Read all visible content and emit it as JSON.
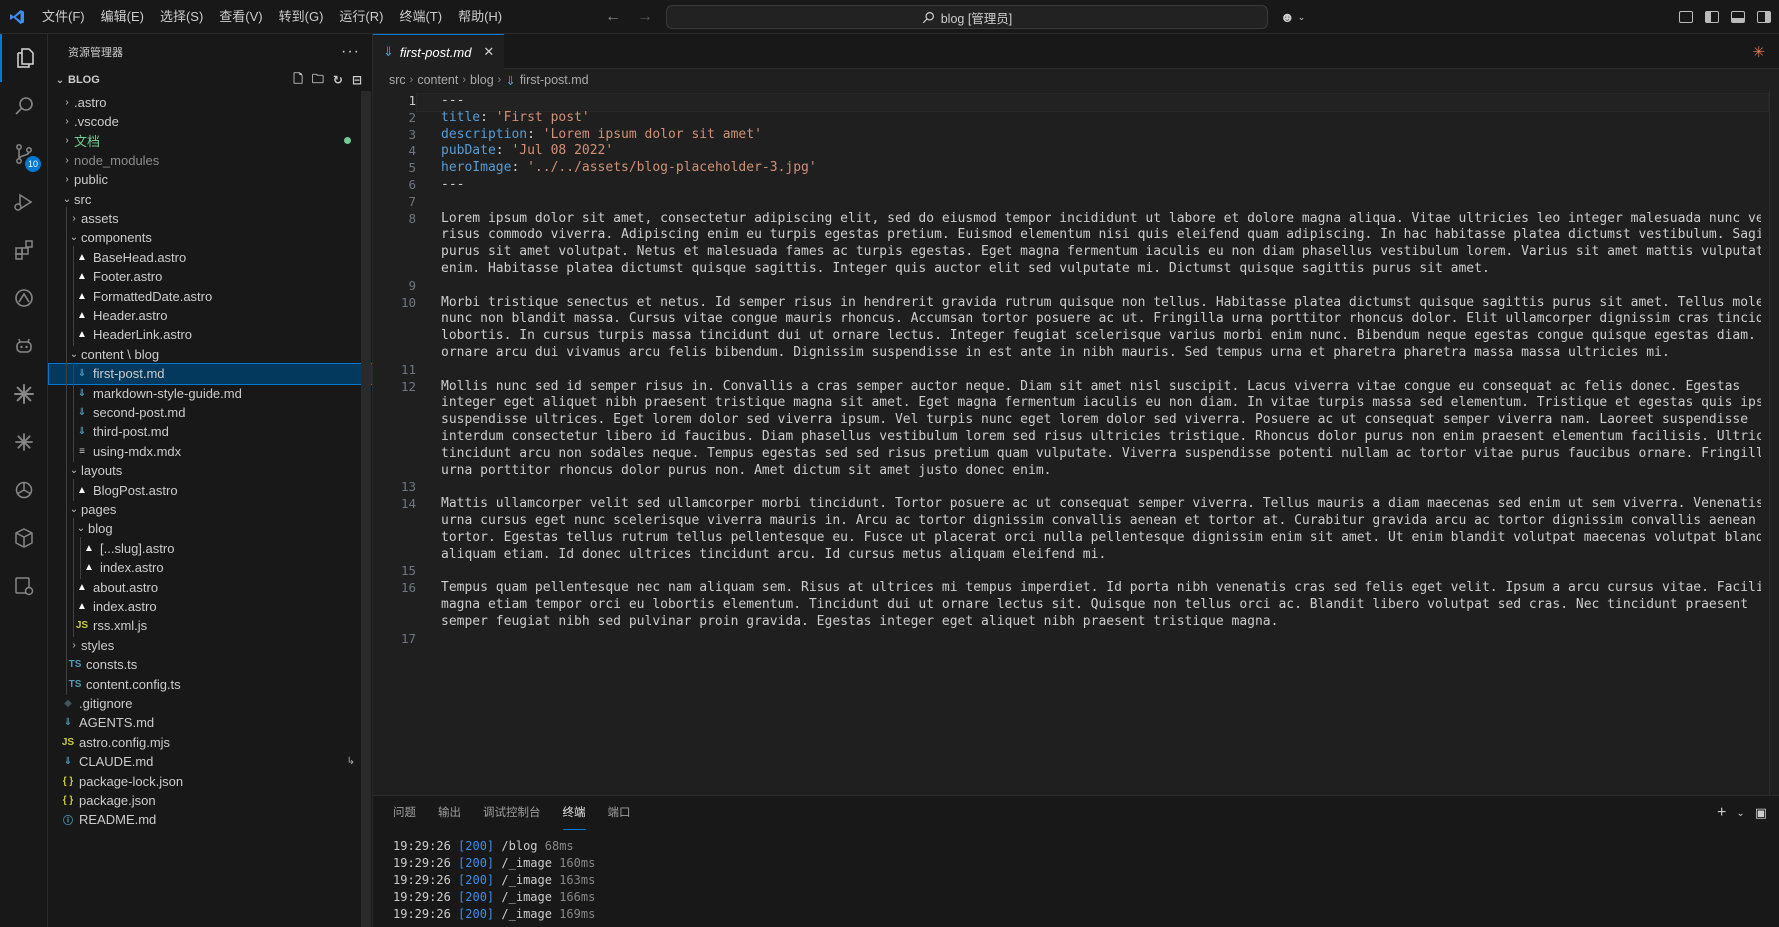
{
  "menu": [
    "文件(F)",
    "编辑(E)",
    "选择(S)",
    "查看(V)",
    "转到(G)",
    "运行(R)",
    "终端(T)",
    "帮助(H)"
  ],
  "search": {
    "text": "blog [管理员]"
  },
  "activity_badge": "10",
  "explorer": {
    "title": "资源管理器",
    "more": "···",
    "root": "BLOG",
    "items": [
      {
        "label": ".astro",
        "depth": 0,
        "type": "folder",
        "open": false
      },
      {
        "label": ".vscode",
        "depth": 0,
        "type": "folder",
        "open": false
      },
      {
        "label": "文档",
        "depth": 0,
        "type": "folder",
        "open": false,
        "modified": true
      },
      {
        "label": "node_modules",
        "depth": 0,
        "type": "folder",
        "open": false,
        "dim": true
      },
      {
        "label": "public",
        "depth": 0,
        "type": "folder",
        "open": false
      },
      {
        "label": "src",
        "depth": 0,
        "type": "folder",
        "open": true
      },
      {
        "label": "assets",
        "depth": 1,
        "type": "folder",
        "open": false
      },
      {
        "label": "components",
        "depth": 1,
        "type": "folder",
        "open": true
      },
      {
        "label": "BaseHead.astro",
        "depth": 2,
        "type": "astro"
      },
      {
        "label": "Footer.astro",
        "depth": 2,
        "type": "astro"
      },
      {
        "label": "FormattedDate.astro",
        "depth": 2,
        "type": "astro"
      },
      {
        "label": "Header.astro",
        "depth": 2,
        "type": "astro"
      },
      {
        "label": "HeaderLink.astro",
        "depth": 2,
        "type": "astro"
      },
      {
        "label": "content \\ blog",
        "depth": 1,
        "type": "folder",
        "open": true
      },
      {
        "label": "first-post.md",
        "depth": 2,
        "type": "md",
        "selected": true
      },
      {
        "label": "markdown-style-guide.md",
        "depth": 2,
        "type": "md"
      },
      {
        "label": "second-post.md",
        "depth": 2,
        "type": "md"
      },
      {
        "label": "third-post.md",
        "depth": 2,
        "type": "md"
      },
      {
        "label": "using-mdx.mdx",
        "depth": 2,
        "type": "mdx"
      },
      {
        "label": "layouts",
        "depth": 1,
        "type": "folder",
        "open": true
      },
      {
        "label": "BlogPost.astro",
        "depth": 2,
        "type": "astro"
      },
      {
        "label": "pages",
        "depth": 1,
        "type": "folder",
        "open": true
      },
      {
        "label": "blog",
        "depth": 2,
        "type": "folder",
        "open": true
      },
      {
        "label": "[...slug].astro",
        "depth": 3,
        "type": "astro"
      },
      {
        "label": "index.astro",
        "depth": 3,
        "type": "astro"
      },
      {
        "label": "about.astro",
        "depth": 2,
        "type": "astro"
      },
      {
        "label": "index.astro",
        "depth": 2,
        "type": "astro"
      },
      {
        "label": "rss.xml.js",
        "depth": 2,
        "type": "js"
      },
      {
        "label": "styles",
        "depth": 1,
        "type": "folder",
        "open": false
      },
      {
        "label": "consts.ts",
        "depth": 1,
        "type": "ts"
      },
      {
        "label": "content.config.ts",
        "depth": 1,
        "type": "ts"
      },
      {
        "label": ".gitignore",
        "depth": 0,
        "type": "git"
      },
      {
        "label": "AGENTS.md",
        "depth": 0,
        "type": "md"
      },
      {
        "label": "astro.config.mjs",
        "depth": 0,
        "type": "js"
      },
      {
        "label": "CLAUDE.md",
        "depth": 0,
        "type": "md",
        "symlink": true
      },
      {
        "label": "package-lock.json",
        "depth": 0,
        "type": "json"
      },
      {
        "label": "package.json",
        "depth": 0,
        "type": "json"
      },
      {
        "label": "README.md",
        "depth": 0,
        "type": "info"
      }
    ]
  },
  "editor": {
    "tab": "first-post.md",
    "breadcrumb": [
      "src",
      "content",
      "blog",
      "first-post.md"
    ],
    "lines": [
      {
        "n": "1",
        "parts": [
          [
            "---",
            ""
          ]
        ]
      },
      {
        "n": "2",
        "parts": [
          [
            "title",
            "k"
          ],
          [
            ": ",
            ""
          ],
          [
            "'First post'",
            "s"
          ]
        ]
      },
      {
        "n": "3",
        "parts": [
          [
            "description",
            "k"
          ],
          [
            ": ",
            ""
          ],
          [
            "'Lorem ipsum dolor sit amet'",
            "s"
          ]
        ]
      },
      {
        "n": "4",
        "parts": [
          [
            "pubDate",
            "k"
          ],
          [
            ": ",
            ""
          ],
          [
            "'Jul 08 2022'",
            "s"
          ]
        ]
      },
      {
        "n": "5",
        "parts": [
          [
            "heroImage",
            "k"
          ],
          [
            ": ",
            ""
          ],
          [
            "'../../assets/blog-placeholder-3.jpg'",
            "s"
          ]
        ]
      },
      {
        "n": "6",
        "parts": [
          [
            "---",
            ""
          ]
        ]
      },
      {
        "n": "7",
        "parts": []
      },
      {
        "n": "8",
        "wrap": [
          "Lorem ipsum dolor sit amet, consectetur adipiscing elit, sed do eiusmod tempor incididunt ut labore et dolore magna aliqua. Vitae ultricies leo integer malesuada nunc vel",
          "risus commodo viverra. Adipiscing enim eu turpis egestas pretium. Euismod elementum nisi quis eleifend quam adipiscing. In hac habitasse platea dictumst vestibulum. Sagittis",
          "purus sit amet volutpat. Netus et malesuada fames ac turpis egestas. Eget magna fermentum iaculis eu non diam phasellus vestibulum lorem. Varius sit amet mattis vulputate",
          "enim. Habitasse platea dictumst quisque sagittis. Integer quis auctor elit sed vulputate mi. Dictumst quisque sagittis purus sit amet."
        ]
      },
      {
        "n": "9",
        "parts": []
      },
      {
        "n": "10",
        "wrap": [
          "Morbi tristique senectus et netus. Id semper risus in hendrerit gravida rutrum quisque non tellus. Habitasse platea dictumst quisque sagittis purus sit amet. Tellus molestie",
          "nunc non blandit massa. Cursus vitae congue mauris rhoncus. Accumsan tortor posuere ac ut. Fringilla urna porttitor rhoncus dolor. Elit ullamcorper dignissim cras tincidunt",
          "lobortis. In cursus turpis massa tincidunt dui ut ornare lectus. Integer feugiat scelerisque varius morbi enim nunc. Bibendum neque egestas congue quisque egestas diam. Cras",
          "ornare arcu dui vivamus arcu felis bibendum. Dignissim suspendisse in est ante in nibh mauris. Sed tempus urna et pharetra pharetra massa massa ultricies mi."
        ]
      },
      {
        "n": "11",
        "parts": []
      },
      {
        "n": "12",
        "wrap": [
          "Mollis nunc sed id semper risus in. Convallis a cras semper auctor neque. Diam sit amet nisl suscipit. Lacus viverra vitae congue eu consequat ac felis donec. Egestas",
          "integer eget aliquet nibh praesent tristique magna sit amet. Eget magna fermentum iaculis eu non diam. In vitae turpis massa sed elementum. Tristique et egestas quis ipsum",
          "suspendisse ultrices. Eget lorem dolor sed viverra ipsum. Vel turpis nunc eget lorem dolor sed viverra. Posuere ac ut consequat semper viverra nam. Laoreet suspendisse",
          "interdum consectetur libero id faucibus. Diam phasellus vestibulum lorem sed risus ultricies tristique. Rhoncus dolor purus non enim praesent elementum facilisis. Ultrices",
          "tincidunt arcu non sodales neque. Tempus egestas sed sed risus pretium quam vulputate. Viverra suspendisse potenti nullam ac tortor vitae purus faucibus ornare. Fringilla",
          "urna porttitor rhoncus dolor purus non. Amet dictum sit amet justo donec enim."
        ]
      },
      {
        "n": "13",
        "parts": []
      },
      {
        "n": "14",
        "wrap": [
          "Mattis ullamcorper velit sed ullamcorper morbi tincidunt. Tortor posuere ac ut consequat semper viverra. Tellus mauris a diam maecenas sed enim ut sem viverra. Venenatis",
          "urna cursus eget nunc scelerisque viverra mauris in. Arcu ac tortor dignissim convallis aenean et tortor at. Curabitur gravida arcu ac tortor dignissim convallis aenean et",
          "tortor. Egestas tellus rutrum tellus pellentesque eu. Fusce ut placerat orci nulla pellentesque dignissim enim sit amet. Ut enim blandit volutpat maecenas volutpat blandit",
          "aliquam etiam. Id donec ultrices tincidunt arcu. Id cursus metus aliquam eleifend mi."
        ]
      },
      {
        "n": "15",
        "parts": []
      },
      {
        "n": "16",
        "wrap": [
          "Tempus quam pellentesque nec nam aliquam sem. Risus at ultrices mi tempus imperdiet. Id porta nibh venenatis cras sed felis eget velit. Ipsum a arcu cursus vitae. Facilisis",
          "magna etiam tempor orci eu lobortis elementum. Tincidunt dui ut ornare lectus sit. Quisque non tellus orci ac. Blandit libero volutpat sed cras. Nec tincidunt praesent",
          "semper feugiat nibh sed pulvinar proin gravida. Egestas integer eget aliquet nibh praesent tristique magna."
        ]
      },
      {
        "n": "17",
        "parts": []
      }
    ]
  },
  "panel": {
    "tabs": [
      "问题",
      "输出",
      "调试控制台",
      "终端",
      "端口"
    ],
    "active_tab": 3,
    "terminal": [
      {
        "time": "19:29:26",
        "code": "[200]",
        "path": "/blog",
        "ms": "68ms"
      },
      {
        "time": "19:29:26",
        "code": "[200]",
        "path": "/_image",
        "ms": "160ms"
      },
      {
        "time": "19:29:26",
        "code": "[200]",
        "path": "/_image",
        "ms": "163ms"
      },
      {
        "time": "19:29:26",
        "code": "[200]",
        "path": "/_image",
        "ms": "166ms"
      },
      {
        "time": "19:29:26",
        "code": "[200]",
        "path": "/_image",
        "ms": "169ms"
      }
    ]
  },
  "colors": {
    "accent": "#0078d4",
    "keyword": "#569cd6",
    "string": "#ce9178",
    "md_icon": "#519aba",
    "astro_icon": "#ffffff",
    "js_icon": "#cbcb41",
    "ts_icon": "#519aba",
    "json_icon": "#cbcb41"
  }
}
